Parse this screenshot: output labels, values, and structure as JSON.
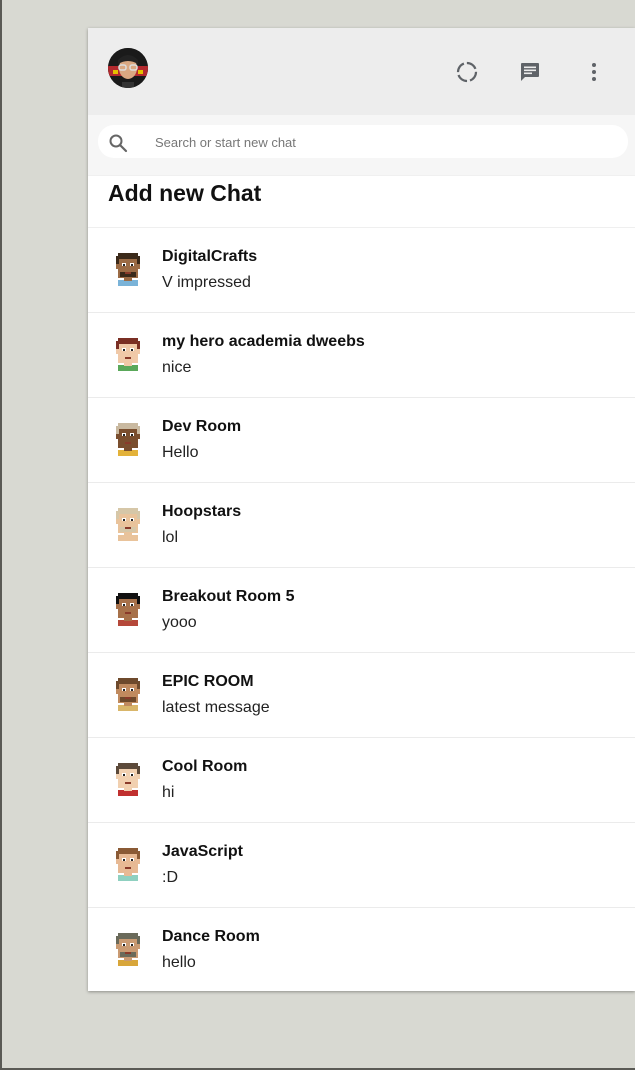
{
  "header": {
    "avatar_icon": "user-avatar-icon",
    "status_icon": "status-circle-icon",
    "new_chat_icon": "chat-bubble-icon",
    "menu_icon": "more-vertical-icon"
  },
  "search": {
    "placeholder": "Search or start new chat",
    "value": ""
  },
  "add_chat": {
    "label": "Add new Chat"
  },
  "chats": [
    {
      "name": "DigitalCrafts",
      "last_message": "V impressed",
      "avatar": {
        "skin": "#9b6b45",
        "hair": "#3b2a1a",
        "shirt": "#7ab3d8",
        "beard": true
      }
    },
    {
      "name": "my hero academia dweebs",
      "last_message": "nice",
      "avatar": {
        "skin": "#f0c9a8",
        "hair": "#7a2f24",
        "shirt": "#5aa85a",
        "beard": false
      }
    },
    {
      "name": "Dev Room",
      "last_message": "Hello",
      "avatar": {
        "skin": "#7a4e2e",
        "hair": "#c9b9a0",
        "shirt": "#e3b23a",
        "beard": false
      }
    },
    {
      "name": "Hoopstars",
      "last_message": "lol",
      "avatar": {
        "skin": "#e9c39b",
        "hair": "#d6c7a8",
        "shirt": "#e9c39b",
        "beard": true
      }
    },
    {
      "name": "Breakout Room 5",
      "last_message": "yooo",
      "avatar": {
        "skin": "#a7714a",
        "hair": "#111111",
        "shirt": "#b5483a",
        "beard": false
      }
    },
    {
      "name": "EPIC ROOM",
      "last_message": "latest message",
      "avatar": {
        "skin": "#c08a5e",
        "hair": "#6e4a2c",
        "shirt": "#d9b66a",
        "beard": true
      }
    },
    {
      "name": "Cool Room",
      "last_message": "hi",
      "avatar": {
        "skin": "#f1d0b0",
        "hair": "#5c4a3a",
        "shirt": "#c0302f",
        "beard": false
      }
    },
    {
      "name": "JavaScript",
      "last_message": ":D",
      "avatar": {
        "skin": "#e7b994",
        "hair": "#8a5a35",
        "shirt": "#8fd0c0",
        "beard": false
      }
    },
    {
      "name": "Dance Room",
      "last_message": "hello",
      "avatar": {
        "skin": "#c99a72",
        "hair": "#6a6a5a",
        "shirt": "#d8a63a",
        "beard": true
      }
    }
  ]
}
